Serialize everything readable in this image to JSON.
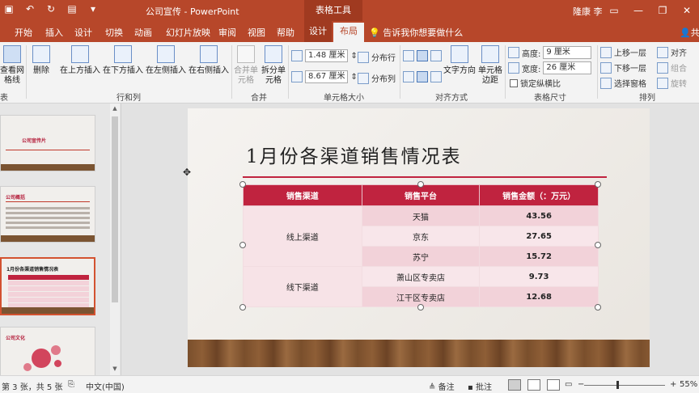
{
  "titlebar": {
    "title": "公司宣传 - PowerPoint",
    "context_tools": "表格工具",
    "user": "隆康 李",
    "qat": {
      "save_icon": "save-icon",
      "undo_icon": "undo-icon",
      "redo_icon": "redo-icon",
      "present_icon": "present-icon",
      "more_icon": "dropdown-icon"
    },
    "minimize": "—",
    "restore": "❐",
    "close": "✕"
  },
  "tabs": [
    "开始",
    "插入",
    "设计",
    "切换",
    "动画",
    "幻灯片放映",
    "审阅",
    "视图",
    "帮助",
    "设计",
    "布局"
  ],
  "active_tab": "布局",
  "tell_me": "告诉我你想要做什么",
  "share": "共",
  "ribbon": {
    "view_gridlines": "查看网格线",
    "delete": "删除",
    "insert_above": "在上方插入",
    "insert_below": "在下方插入",
    "insert_left": "在左侧插入",
    "insert_right": "在右侧插入",
    "merge_cells": "合并单元格",
    "split_cells": "拆分单元格",
    "cell_height": "1.48 厘米",
    "cell_width": "8.67 厘米",
    "distribute_rows": "分布行",
    "distribute_cols": "分布列",
    "text_direction": "文字方向",
    "cell_margins": "单元格边距",
    "height_label": "高度:",
    "height_value": "9 厘米",
    "width_label": "宽度:",
    "width_value": "26 厘米",
    "lock_ratio": "锁定纵横比",
    "bring_forward": "上移一层",
    "send_backward": "下移一层",
    "selection_pane": "选择窗格",
    "align": "对齐",
    "group": "组合",
    "rotate": "旋转",
    "groups": {
      "table": "表",
      "rows_cols": "行和列",
      "merge": "合并",
      "cell_size": "单元格大小",
      "alignment": "对齐方式",
      "table_size": "表格尺寸",
      "arrange": "排列"
    }
  },
  "thumbnails": [
    {
      "title": "公司宣传片"
    },
    {
      "title": "公司概括"
    },
    {
      "title": "1月份各渠道销售情况表"
    },
    {
      "title": "公司文化"
    }
  ],
  "slide": {
    "title": "1月份各渠道销售情况表",
    "table": {
      "headers": [
        "销售渠道",
        "销售平台",
        "销售金额（：万元）"
      ],
      "groups": [
        {
          "channel": "线上渠道",
          "rows": [
            {
              "platform": "天猫",
              "amount": "43.56"
            },
            {
              "platform": "京东",
              "amount": "27.65"
            },
            {
              "platform": "苏宁",
              "amount": "15.72"
            }
          ]
        },
        {
          "channel": "线下渠道",
          "rows": [
            {
              "platform": "萧山区专卖店",
              "amount": "9.73"
            },
            {
              "platform": "江干区专卖店",
              "amount": "12.68"
            }
          ]
        }
      ]
    }
  },
  "statusbar": {
    "slide_info": "第 3 张，共 5 张",
    "language": "中文(中国)",
    "notes": "备注",
    "comments": "批注",
    "zoom_minus": "−",
    "zoom_plus": "+",
    "zoom": "55%"
  },
  "colors": {
    "accent": "#b7472a",
    "table_header": "#c0233f",
    "table_row_light": "#f8e6ea",
    "table_row_dark": "#f2d2d9"
  }
}
